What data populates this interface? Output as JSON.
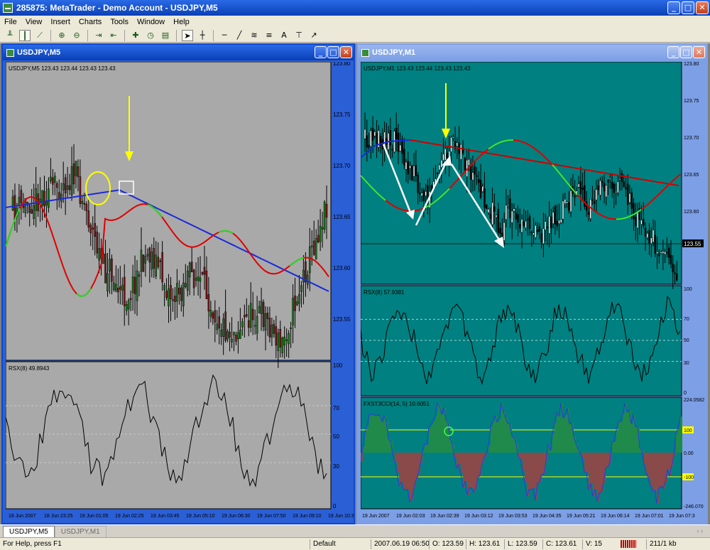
{
  "app": {
    "title": "285875: MetaTrader - Demo Account - USDJPY,M5"
  },
  "menu": [
    "File",
    "View",
    "Insert",
    "Charts",
    "Tools",
    "Window",
    "Help"
  ],
  "toolbar_icons": [
    "bar-chart-icon",
    "candlestick-icon",
    "line-chart-icon",
    "zoom-in-icon",
    "zoom-out-icon",
    "autoscroll-icon",
    "chart-shift-icon",
    "indicators-icon",
    "periods-icon",
    "templates-icon",
    "cursor-icon",
    "crosshair-icon",
    "horizontal-line-icon",
    "trendline-icon",
    "fibonacci-icon",
    "channel-icon",
    "text-icon",
    "text-label-icon",
    "arrows-icon"
  ],
  "toolbar_text": {
    "text_tool": "A"
  },
  "left_window": {
    "title": "USDJPY,M5",
    "info": "USDJPY,M5  123.43 123.44 123.43 123.43",
    "price_ticks": [
      "123.80",
      "123.75",
      "123.70",
      "123.65",
      "123.60",
      "123.55"
    ],
    "rsx_label": "RSX(8) 49.8943",
    "rsx_ticks": [
      "100",
      "70",
      "50",
      "30",
      "0"
    ],
    "time_ticks": [
      "18 Jun 2007",
      "18 Jun 23:25",
      "19 Jun 01:05",
      "19 Jun 02:25",
      "19 Jun 03:45",
      "19 Jun 05:10",
      "19 Jun 06:30",
      "19 Jun 07:50",
      "19 Jun 09:10",
      "19 Jun 10:3"
    ]
  },
  "right_window": {
    "title": "USDJPY,M1",
    "info": "USDJPY,M1  123.43 123.44 123.43 123.43",
    "price_ticks": [
      "123.80",
      "123.75",
      "123.70",
      "123.65",
      "123.60"
    ],
    "last_price": "123.55",
    "rsx_label": "RSX(8) 57.9381",
    "rsx_ticks": [
      "100",
      "70",
      "50",
      "30",
      "0"
    ],
    "cci_label": "FXST3CCI(14, 5) 10.6051",
    "cci_ticks": [
      "224.0582",
      "100",
      "0.00",
      "-100",
      "-246.070"
    ],
    "time_ticks": [
      "19 Jun 2007",
      "19 Jun 02:03",
      "19 Jun 02:39",
      "19 Jun 03:12",
      "19 Jun 03:53",
      "19 Jun 04:35",
      "19 Jun 05:21",
      "19 Jun 06:14",
      "19 Jun 07:01",
      "19 Jun 07:3"
    ]
  },
  "tabs": [
    {
      "label": "USDJPY,M5",
      "active": true
    },
    {
      "label": "USDJPY,M1",
      "active": false
    }
  ],
  "status": {
    "help": "For Help, press F1",
    "profile": "Default",
    "datetime": "2007.06.19 06:50",
    "open": "O: 123.59",
    "high": "H: 123.61",
    "low": "L: 123.59",
    "close": "C: 123.61",
    "volume": "V: 15",
    "traffic": "211/1 kb"
  },
  "colors": {
    "left_bg": "#a9a9a9",
    "right_bg": "#008080",
    "ma_red": "#e00000",
    "ma_green": "#22dd22",
    "ma_blue": "#1a2ad8",
    "arrow_yellow": "#ffff00",
    "cci_green": "#1f8a4a",
    "cci_red": "#8a4a4a"
  }
}
